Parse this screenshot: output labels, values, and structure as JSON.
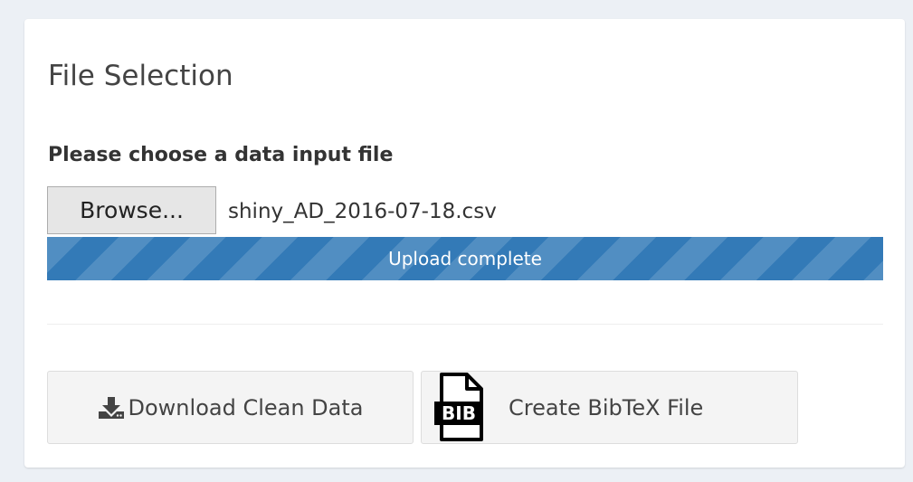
{
  "panel": {
    "title": "File Selection"
  },
  "file_input": {
    "label": "Please choose a data input file",
    "browse_label": "Browse...",
    "file_name": "shiny_AD_2016-07-18.csv"
  },
  "progress": {
    "status_text": "Upload complete",
    "percent": 100,
    "color": "#337ab7"
  },
  "actions": {
    "download_label": "Download Clean Data",
    "download_icon": "download-icon",
    "bibtex_label": "Create BibTeX File",
    "bibtex_icon": "bib-file-icon"
  }
}
